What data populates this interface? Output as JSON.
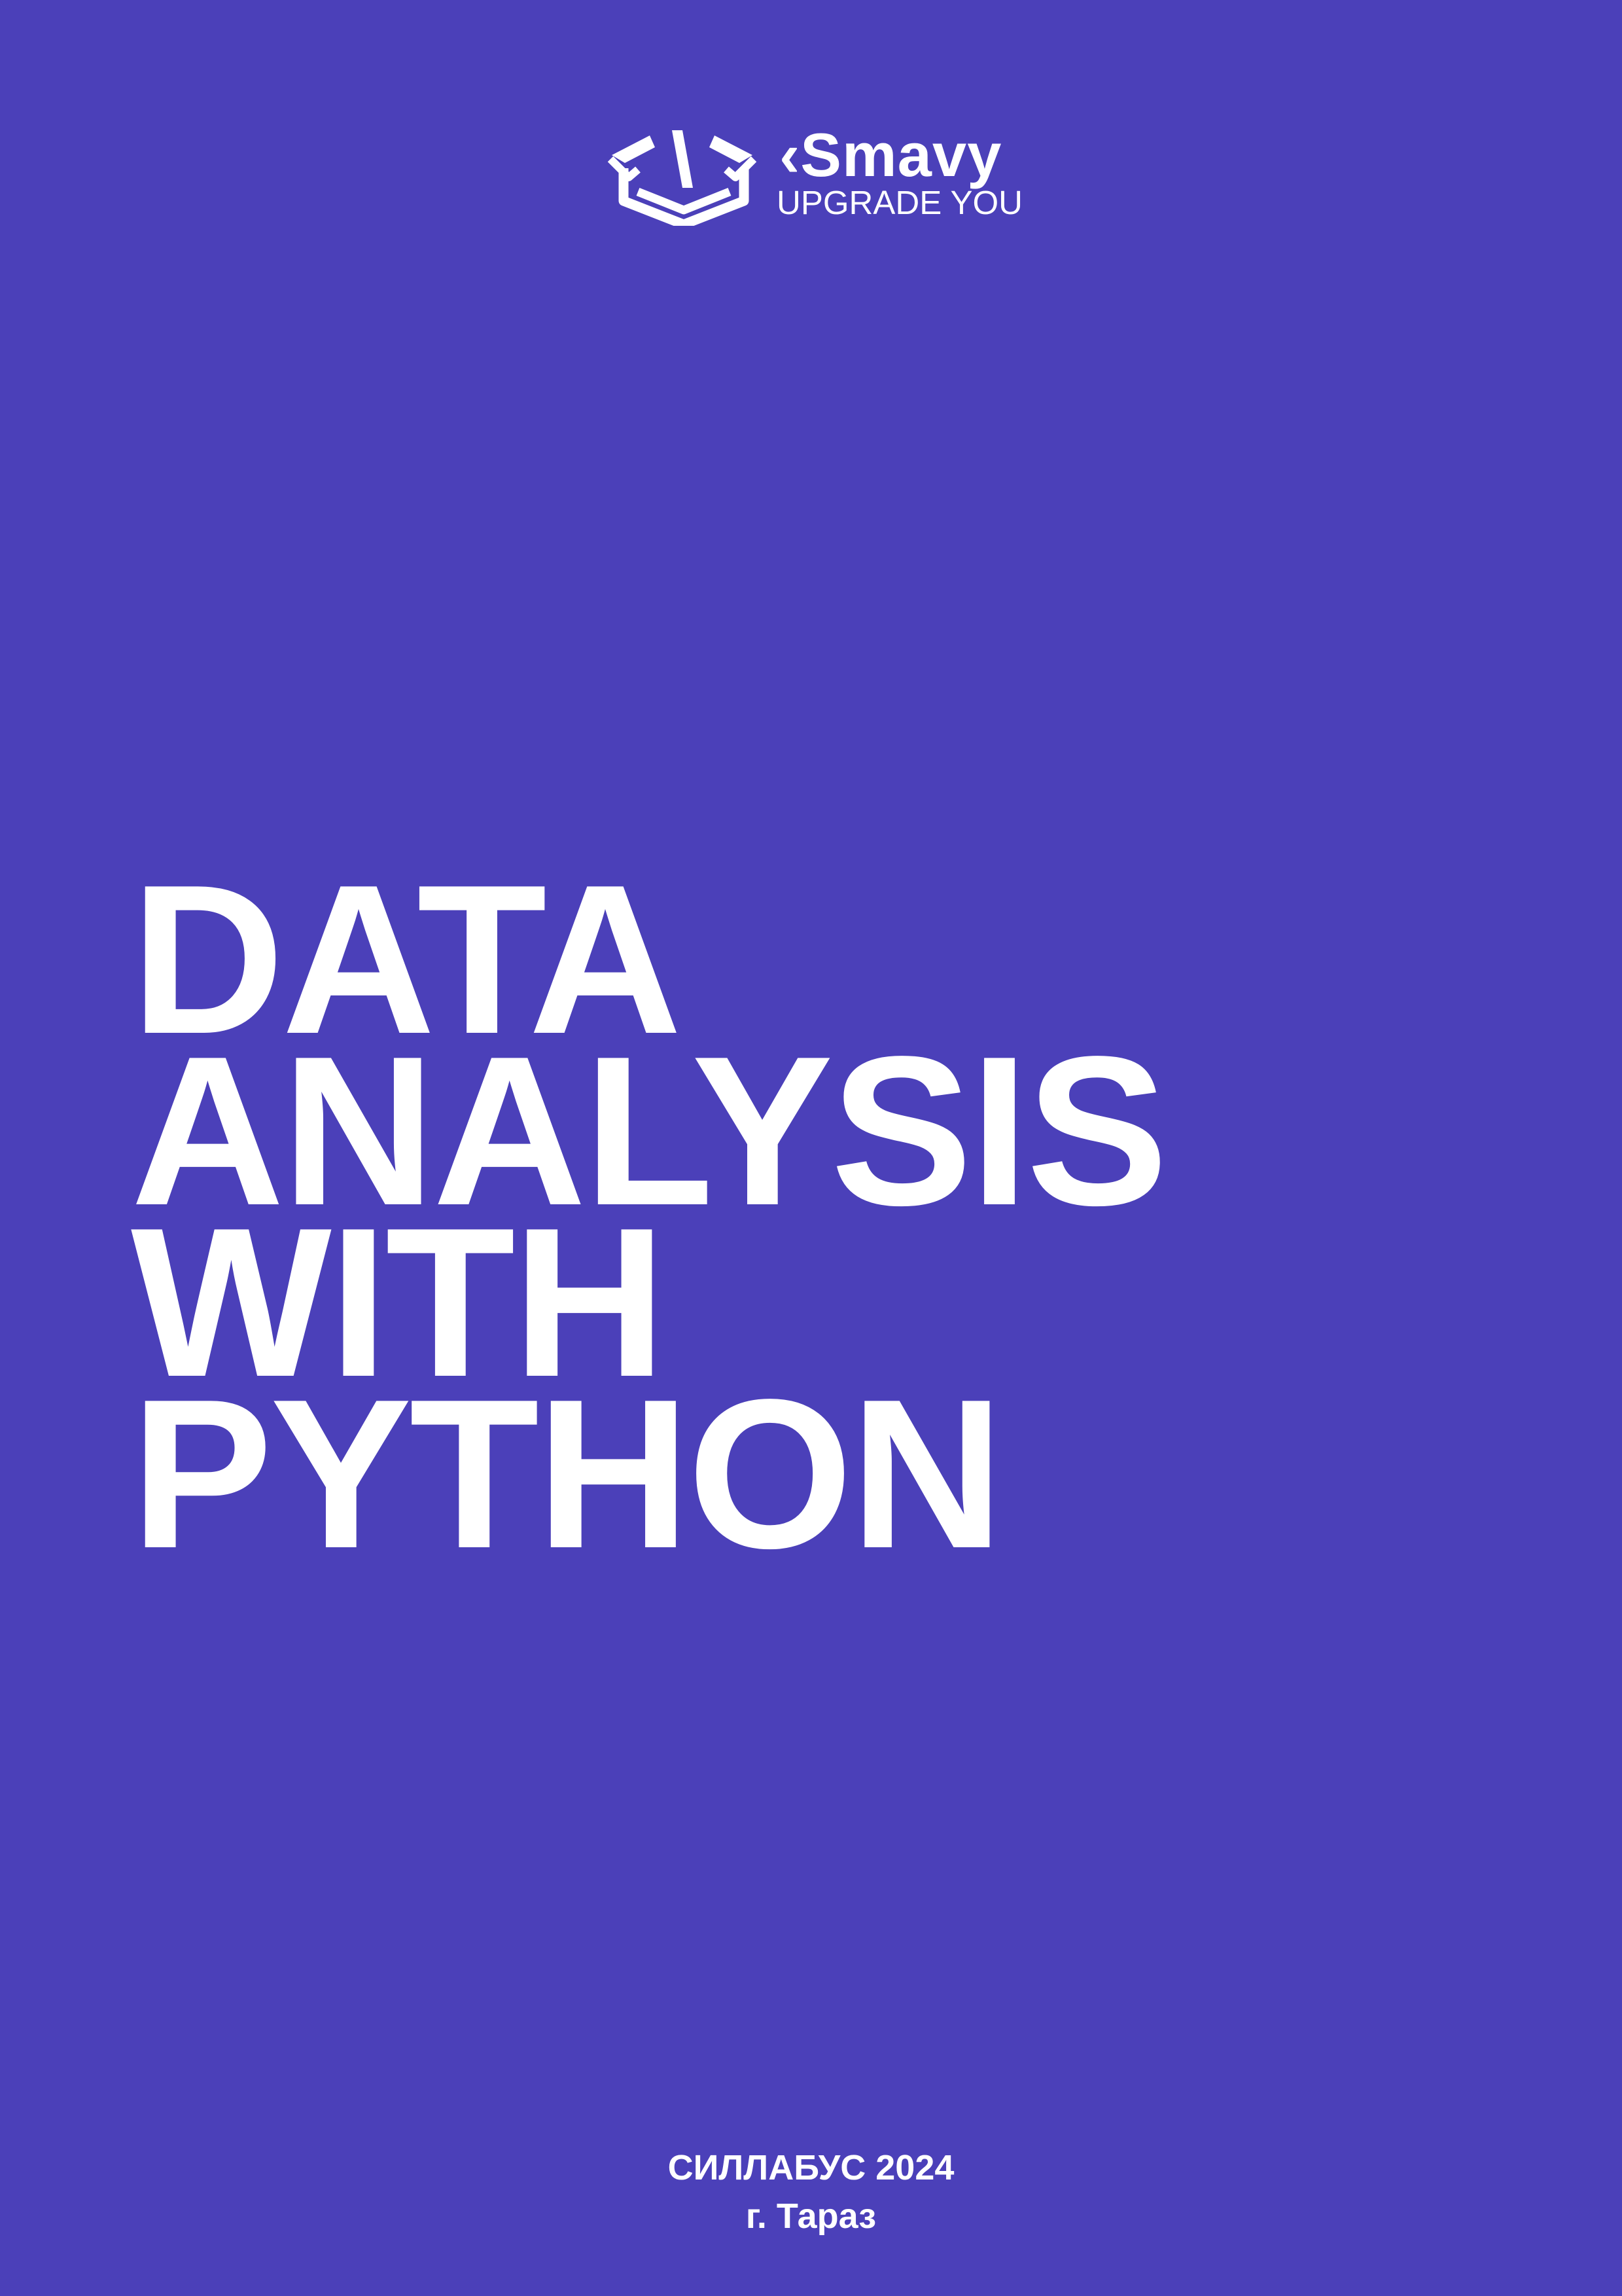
{
  "logo": {
    "brand": "‹Smavy",
    "tagline": "UPGRADE YOU",
    "icon": "open-box-code-icon"
  },
  "title": {
    "lines": [
      "DATA",
      "ANALYSIS",
      "WITH",
      "PYTHON"
    ]
  },
  "footer": {
    "line1": "СИЛЛАБУС 2024",
    "line2": "г. Тараз"
  },
  "colors": {
    "background": "#4b40b9",
    "foreground": "#ffffff"
  }
}
